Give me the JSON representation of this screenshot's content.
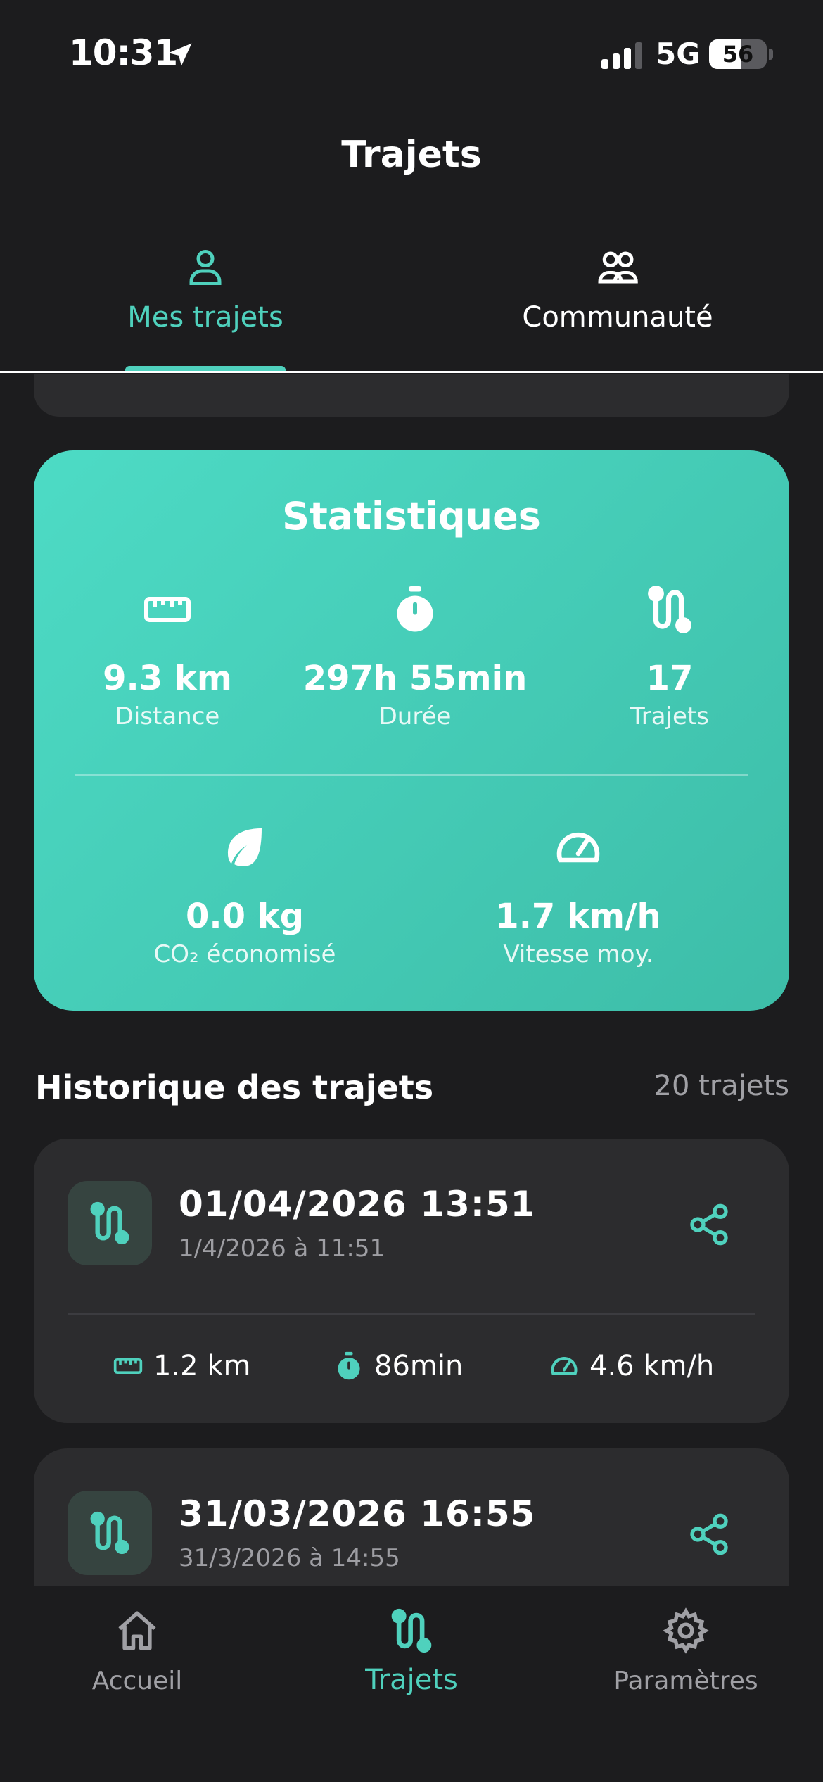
{
  "status": {
    "time": "10:31",
    "network": "5G",
    "battery": "56",
    "battery_level": 0.56
  },
  "header": {
    "title": "Trajets"
  },
  "tabs": [
    {
      "label": "Mes trajets",
      "icon": "person-icon",
      "active": true
    },
    {
      "label": "Communauté",
      "icon": "people-icon",
      "active": false
    }
  ],
  "stats": {
    "title": "Statistiques",
    "distance": {
      "value": "9.3 km",
      "label": "Distance",
      "icon": "ruler-icon"
    },
    "duration": {
      "value": "297h 55min",
      "label": "Durée",
      "icon": "stopwatch-icon"
    },
    "trips": {
      "value": "17",
      "label": "Trajets",
      "icon": "route-icon"
    },
    "co2": {
      "value": "0.0 kg",
      "label": "CO₂ économisé",
      "icon": "leaf-icon"
    },
    "speed": {
      "value": "1.7 km/h",
      "label": "Vitesse moy.",
      "icon": "speedometer-icon"
    }
  },
  "history": {
    "title": "Historique des trajets",
    "count": "20 trajets",
    "trips": [
      {
        "title": "01/04/2026 13:51",
        "subtitle": "1/4/2026 à 11:51",
        "distance": "1.2 km",
        "duration": "86min",
        "speed": "4.6 km/h"
      },
      {
        "title": "31/03/2026 16:55",
        "subtitle": "31/3/2026 à 14:55"
      }
    ]
  },
  "nav": [
    {
      "label": "Accueil",
      "icon": "home-icon",
      "active": false
    },
    {
      "label": "Trajets",
      "icon": "route-icon",
      "active": true
    },
    {
      "label": "Paramètres",
      "icon": "gear-icon",
      "active": false
    }
  ],
  "colors": {
    "accent": "#4fd1bd",
    "background": "#1c1c1e",
    "card": "#2c2c2e"
  }
}
